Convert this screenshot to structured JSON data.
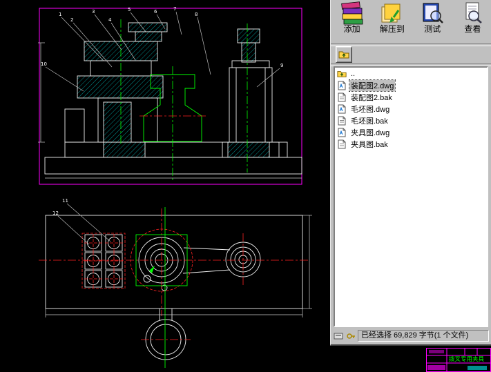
{
  "archiver": {
    "toolbar": {
      "add": "添加",
      "extract": "解压到",
      "test": "测试",
      "view": "查看"
    },
    "files": [
      {
        "name": "..",
        "type": "up",
        "selected": false
      },
      {
        "name": "装配图2.dwg",
        "type": "dwg",
        "selected": true
      },
      {
        "name": "装配图2.bak",
        "type": "bak",
        "selected": false
      },
      {
        "name": "毛坯图.dwg",
        "type": "dwg",
        "selected": false
      },
      {
        "name": "毛坯图.bak",
        "type": "bak",
        "selected": false
      },
      {
        "name": "夹具图.dwg",
        "type": "dwg",
        "selected": false
      },
      {
        "name": "夹具图.bak",
        "type": "bak",
        "selected": false
      }
    ],
    "status_text": "已经选择 69,829 字节(1 个文件)"
  },
  "cad": {
    "callouts": [
      "1",
      "2",
      "3",
      "4",
      "5",
      "6",
      "7",
      "8",
      "9",
      "10",
      "11",
      "12"
    ],
    "title_block": {
      "title": "拨叉专用夹具"
    },
    "colors": {
      "line": "#f0f0f0",
      "hatch": "#00b8b8",
      "center": "#00ff00",
      "hidden": "#ff2222",
      "border": "#ff00ff"
    }
  }
}
